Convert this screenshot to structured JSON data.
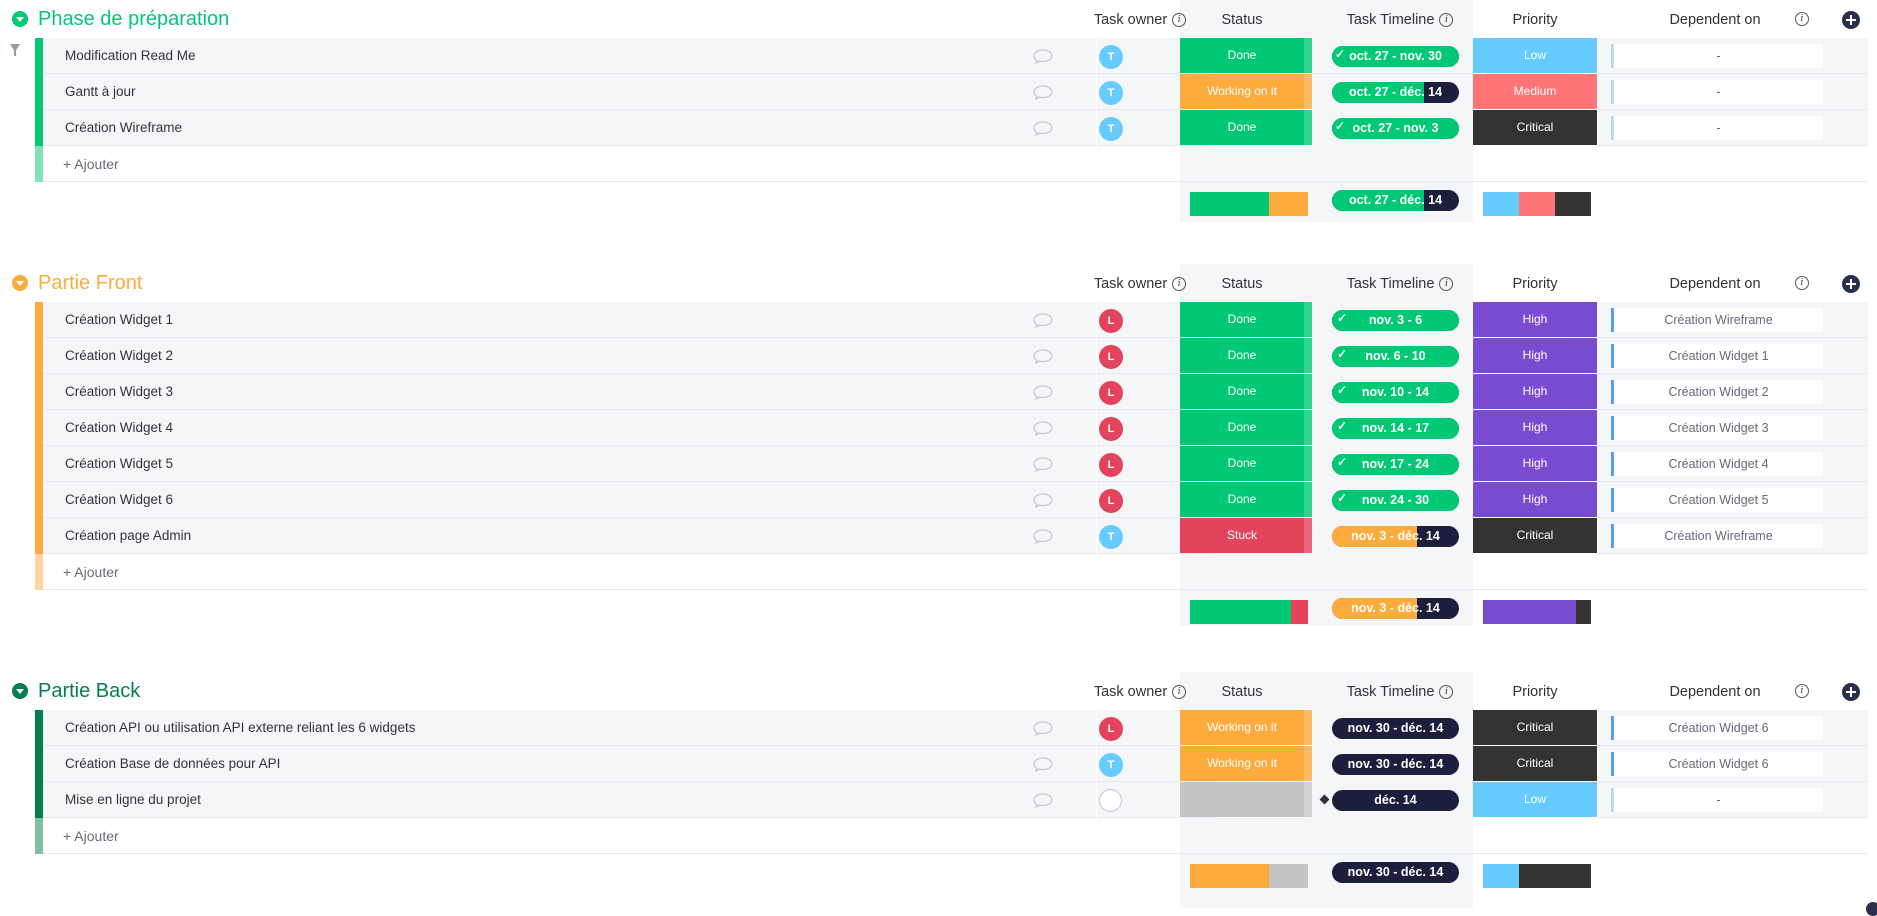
{
  "columns": {
    "owner": "Task owner",
    "status": "Status",
    "timeline": "Task Timeline",
    "priority": "Priority",
    "dependent": "Dependent on"
  },
  "add_label": "+ Ajouter",
  "colors": {
    "done": "#00c875",
    "working": "#fdab3d",
    "stuck": "#e2445c",
    "empty": "#c4c4c4",
    "low": "#66ccff",
    "medium": "#ff7575",
    "high": "#784bd1",
    "critical": "#333333",
    "timeline_dark": "#1c1f3b"
  },
  "groups": [
    {
      "title": "Phase de préparation",
      "color": "#00c875",
      "rows": [
        {
          "name": "Modification Read Me",
          "owner": "T",
          "status": "Done",
          "timeline": "oct. 27 - nov. 30",
          "priority": "Low",
          "dependent": "-"
        },
        {
          "name": "Gantt à jour",
          "owner": "T",
          "status": "Working on it",
          "timeline": "oct. 27 - déc. 14",
          "priority": "Medium",
          "dependent": "-"
        },
        {
          "name": "Création Wireframe",
          "owner": "T",
          "status": "Done",
          "timeline": "oct. 27 - nov. 3",
          "priority": "Critical",
          "dependent": "-"
        }
      ],
      "summary": {
        "timeline": "oct. 27 - déc. 14"
      }
    },
    {
      "title": "Partie Front",
      "color": "#fdab3d",
      "rows": [
        {
          "name": "Création Widget 1",
          "owner": "L",
          "status": "Done",
          "timeline": "nov. 3 - 6",
          "priority": "High",
          "dependent": "Création Wireframe"
        },
        {
          "name": "Création Widget 2",
          "owner": "L",
          "status": "Done",
          "timeline": "nov. 6 - 10",
          "priority": "High",
          "dependent": "Création Widget 1"
        },
        {
          "name": "Création Widget 3",
          "owner": "L",
          "status": "Done",
          "timeline": "nov. 10 - 14",
          "priority": "High",
          "dependent": "Création Widget 2"
        },
        {
          "name": "Création Widget 4",
          "owner": "L",
          "status": "Done",
          "timeline": "nov. 14 - 17",
          "priority": "High",
          "dependent": "Création Widget 3"
        },
        {
          "name": "Création Widget 5",
          "owner": "L",
          "status": "Done",
          "timeline": "nov. 17 - 24",
          "priority": "High",
          "dependent": "Création Widget 4"
        },
        {
          "name": "Création Widget 6",
          "owner": "L",
          "status": "Done",
          "timeline": "nov. 24 - 30",
          "priority": "High",
          "dependent": "Création Widget 5"
        },
        {
          "name": "Création page Admin",
          "owner": "T",
          "status": "Stuck",
          "timeline": "nov. 3 - déc. 14",
          "priority": "Critical",
          "dependent": "Création Wireframe"
        }
      ],
      "summary": {
        "timeline": "nov. 3 - déc. 14"
      }
    },
    {
      "title": "Partie Back",
      "color": "#037f4c",
      "rows": [
        {
          "name": "Création API ou utilisation API externe reliant les 6 widgets",
          "owner": "L",
          "status": "Working on it",
          "timeline": "nov. 30 - déc. 14",
          "priority": "Critical",
          "dependent": "Création Widget 6"
        },
        {
          "name": "Création Base de données pour API",
          "owner": "T",
          "status": "Working on it",
          "timeline": "nov. 30 - déc. 14",
          "priority": "Critical",
          "dependent": "Création Widget 6"
        },
        {
          "name": "Mise en ligne du projet",
          "owner": "",
          "status": "",
          "timeline": "déc. 14",
          "priority": "Low",
          "dependent": "-"
        }
      ],
      "summary": {
        "timeline": "nov. 30 - déc. 14"
      }
    }
  ]
}
